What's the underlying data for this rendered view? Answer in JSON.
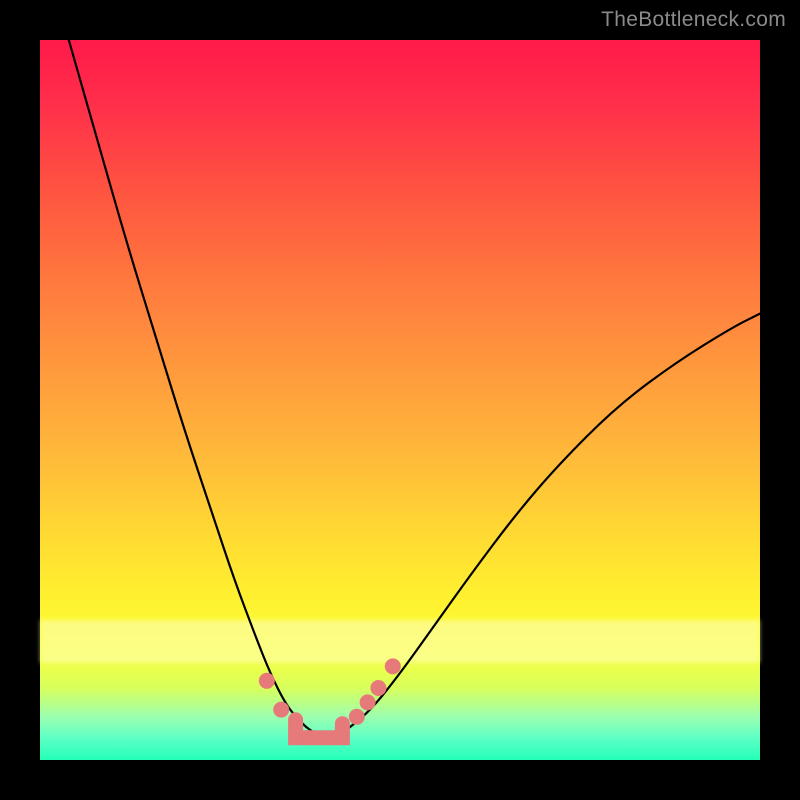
{
  "watermark": "TheBottleneck.com",
  "colors": {
    "background": "#000000",
    "curve": "#000000",
    "marker": "#e67a7a",
    "gradient_top": "#ff1a4a",
    "gradient_bottom": "#24ffb8"
  },
  "chart_data": {
    "type": "line",
    "title": "",
    "xlabel": "",
    "ylabel": "",
    "xlim": [
      0,
      100
    ],
    "ylim": [
      0,
      100
    ],
    "grid": false,
    "legend": false,
    "series": [
      {
        "name": "bottleneck-curve",
        "x": [
          4,
          8,
          12,
          16,
          20,
          24,
          27,
          30,
          32,
          34,
          35.5,
          37,
          38.5,
          40,
          41.5,
          43,
          46,
          50,
          55,
          60,
          66,
          72,
          80,
          88,
          96,
          100
        ],
        "y": [
          100,
          86,
          72,
          59,
          46,
          34,
          25,
          17,
          12,
          8,
          6,
          4.5,
          3.5,
          3,
          3.5,
          4.5,
          7,
          12,
          19,
          26,
          34,
          41,
          49,
          55,
          60,
          62
        ]
      }
    ],
    "markers": [
      {
        "name": "dot-left-upper",
        "x": 31.5,
        "y": 11
      },
      {
        "name": "dot-left-lower",
        "x": 33.5,
        "y": 7
      },
      {
        "name": "dot-right-1",
        "x": 44.0,
        "y": 6
      },
      {
        "name": "dot-right-2",
        "x": 45.5,
        "y": 8
      },
      {
        "name": "dot-right-3",
        "x": 47.0,
        "y": 10
      },
      {
        "name": "dot-right-upper",
        "x": 49.0,
        "y": 13
      }
    ],
    "bottom_segment": {
      "x_start": 35.5,
      "x_end": 42.0,
      "y": 3.1
    },
    "annotations": []
  }
}
